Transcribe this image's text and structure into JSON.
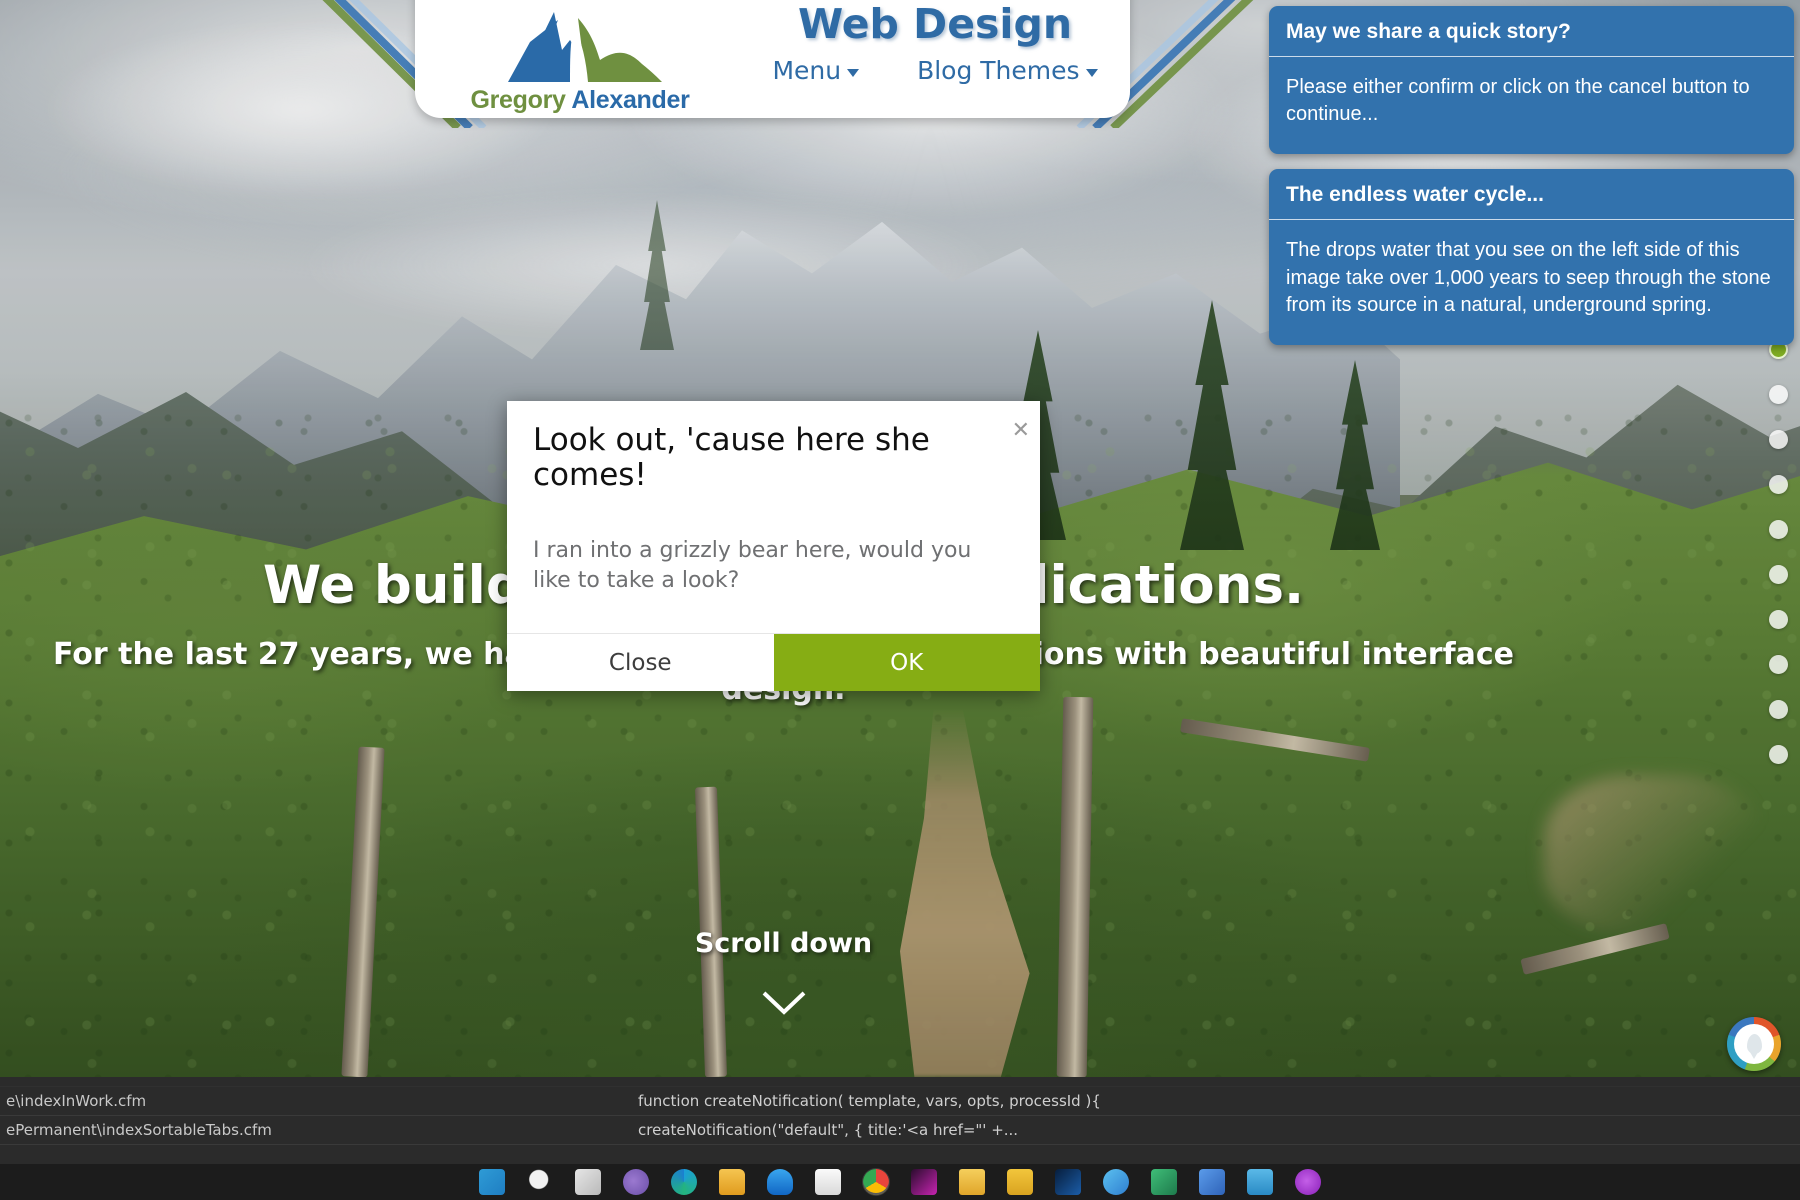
{
  "header": {
    "logo_name_part1": "Gregory ",
    "logo_name_part2": "Alexander",
    "site_title": "Web Design",
    "nav": [
      {
        "label": "Menu",
        "icon": "chevron-down-icon"
      },
      {
        "label": "Blog Themes",
        "icon": "chevron-down-icon"
      }
    ],
    "brand_blue": "#2f6ba5",
    "brand_green": "#6f9040"
  },
  "notifications": [
    {
      "title": "May we share a quick story?",
      "body": "Please either confirm or click on the cancel button to continue...",
      "color": "#3272ad"
    },
    {
      "title": "The endless water cycle...",
      "body": "The drops water that you see on the left side of this image take over 1,000 years to seep through the stone from its source in a natural, underground spring.",
      "color": "#3272ad"
    }
  ],
  "hero": {
    "headline": "We build custom web applications.",
    "subhead": "For the last 27 years, we have been building web applications with beautiful interface design.",
    "scroll_label": "Scroll down",
    "scroll_icon": "chevron-down-icon"
  },
  "dotnav": {
    "active_index": 0,
    "count": 10,
    "active_color": "#7fad22",
    "inactive_color": "#ffffff"
  },
  "seal": {
    "name": "site-seal-badge"
  },
  "modal": {
    "title": "Look out, 'cause here she comes!",
    "close_icon": "close-icon",
    "body": "I ran into a grizzly bear here, would you like to take a look?",
    "buttons": {
      "secondary": "Close",
      "primary": "OK",
      "primary_color": "#86ad14"
    }
  },
  "editor": {
    "rows": [
      {
        "left": "",
        "right": ""
      },
      {
        "left": "e\\indexInWork.cfm",
        "right": "function createNotification( template, vars, opts, processId ){"
      },
      {
        "left": "ePermanent\\indexSortableTabs.cfm",
        "right": "createNotification(\"default\", { title:'<a href=\"' +..."
      }
    ]
  },
  "taskbar": {
    "icons": [
      {
        "name": "start-windows-icon",
        "color": "#2e9bd6"
      },
      {
        "name": "search-icon",
        "color": "#d8d8d8"
      },
      {
        "name": "task-view-icon",
        "color": "#cfcfcf"
      },
      {
        "name": "cortana-icon",
        "color": "#8a6fc4"
      },
      {
        "name": "edge-browser-icon",
        "color": "#28b4d8"
      },
      {
        "name": "file-explorer-icon",
        "color": "#f0b429"
      },
      {
        "name": "onedrive-icon",
        "color": "#1e7fd4"
      },
      {
        "name": "microsoft-store-icon",
        "color": "#f2f2f2"
      },
      {
        "name": "chrome-browser-icon",
        "color": "#e8453c"
      },
      {
        "name": "dreamweaver-icon",
        "color": "#c724b1"
      },
      {
        "name": "folder-icon",
        "color": "#f0c040"
      },
      {
        "name": "notes-icon",
        "color": "#e8b832"
      },
      {
        "name": "photoshop-icon",
        "color": "#1b5da8"
      },
      {
        "name": "mail-icon",
        "color": "#2f7fd0"
      },
      {
        "name": "excel-icon",
        "color": "#2ea36a"
      },
      {
        "name": "teams-icon",
        "color": "#3b7fd4"
      },
      {
        "name": "calendar-icon",
        "color": "#3aa0d8"
      },
      {
        "name": "chat-icon",
        "color": "#a23fd0"
      }
    ]
  }
}
